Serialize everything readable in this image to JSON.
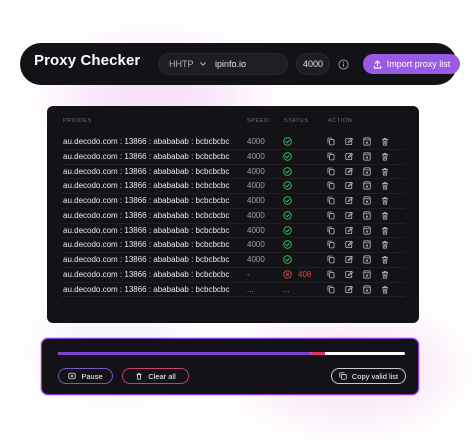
{
  "header": {
    "title": "Proxy Checker",
    "protocol": "HHTP",
    "url_value": "ipinfo.io",
    "timeout_value": "4000",
    "import_label": "Import proxy list"
  },
  "table": {
    "columns": {
      "proxies": "PROXIES",
      "speed": "SPEED",
      "status": "STATUS",
      "action": "ACTION"
    },
    "rows": [
      {
        "proxy": "au.decodo.com : 13866 : abababab : bcbcbcbc",
        "speed": "4000",
        "status": "ok",
        "code": ""
      },
      {
        "proxy": "au.decodo.com : 13866 : abababab : bcbcbcbc",
        "speed": "4000",
        "status": "ok",
        "code": ""
      },
      {
        "proxy": "au.decodo.com : 13866 : abababab : bcbcbcbc",
        "speed": "4000",
        "status": "ok",
        "code": ""
      },
      {
        "proxy": "au.decodo.com : 13866 : abababab : bcbcbcbc",
        "speed": "4000",
        "status": "ok",
        "code": ""
      },
      {
        "proxy": "au.decodo.com : 13866 : abababab : bcbcbcbc",
        "speed": "4000",
        "status": "ok",
        "code": ""
      },
      {
        "proxy": "au.decodo.com : 13866 : abababab : bcbcbcbc",
        "speed": "4000",
        "status": "ok",
        "code": ""
      },
      {
        "proxy": "au.decodo.com : 13866 : abababab : bcbcbcbc",
        "speed": "4000",
        "status": "ok",
        "code": ""
      },
      {
        "proxy": "au.decodo.com : 13866 : abababab : bcbcbcbc",
        "speed": "4000",
        "status": "ok",
        "code": ""
      },
      {
        "proxy": "au.decodo.com : 13866 : abababab : bcbcbcbc",
        "speed": "4000",
        "status": "ok",
        "code": ""
      },
      {
        "proxy": "au.decodo.com : 13866 : abababab : bcbcbcbc",
        "speed": "-",
        "status": "error",
        "code": "408"
      },
      {
        "proxy": "au.decodo.com : 13866 : abababab : bcbcbcbc",
        "speed": "...",
        "status": "pending",
        "code": "..."
      }
    ]
  },
  "controls": {
    "progress_done": 0.73,
    "progress_failed": 0.04,
    "pause_label": "Pause",
    "clear_label": "Clear all",
    "copy_label": "Copy valid list"
  },
  "colors": {
    "accent": "#9b5ae4",
    "ok": "#39c46d",
    "error": "#e3464d"
  }
}
